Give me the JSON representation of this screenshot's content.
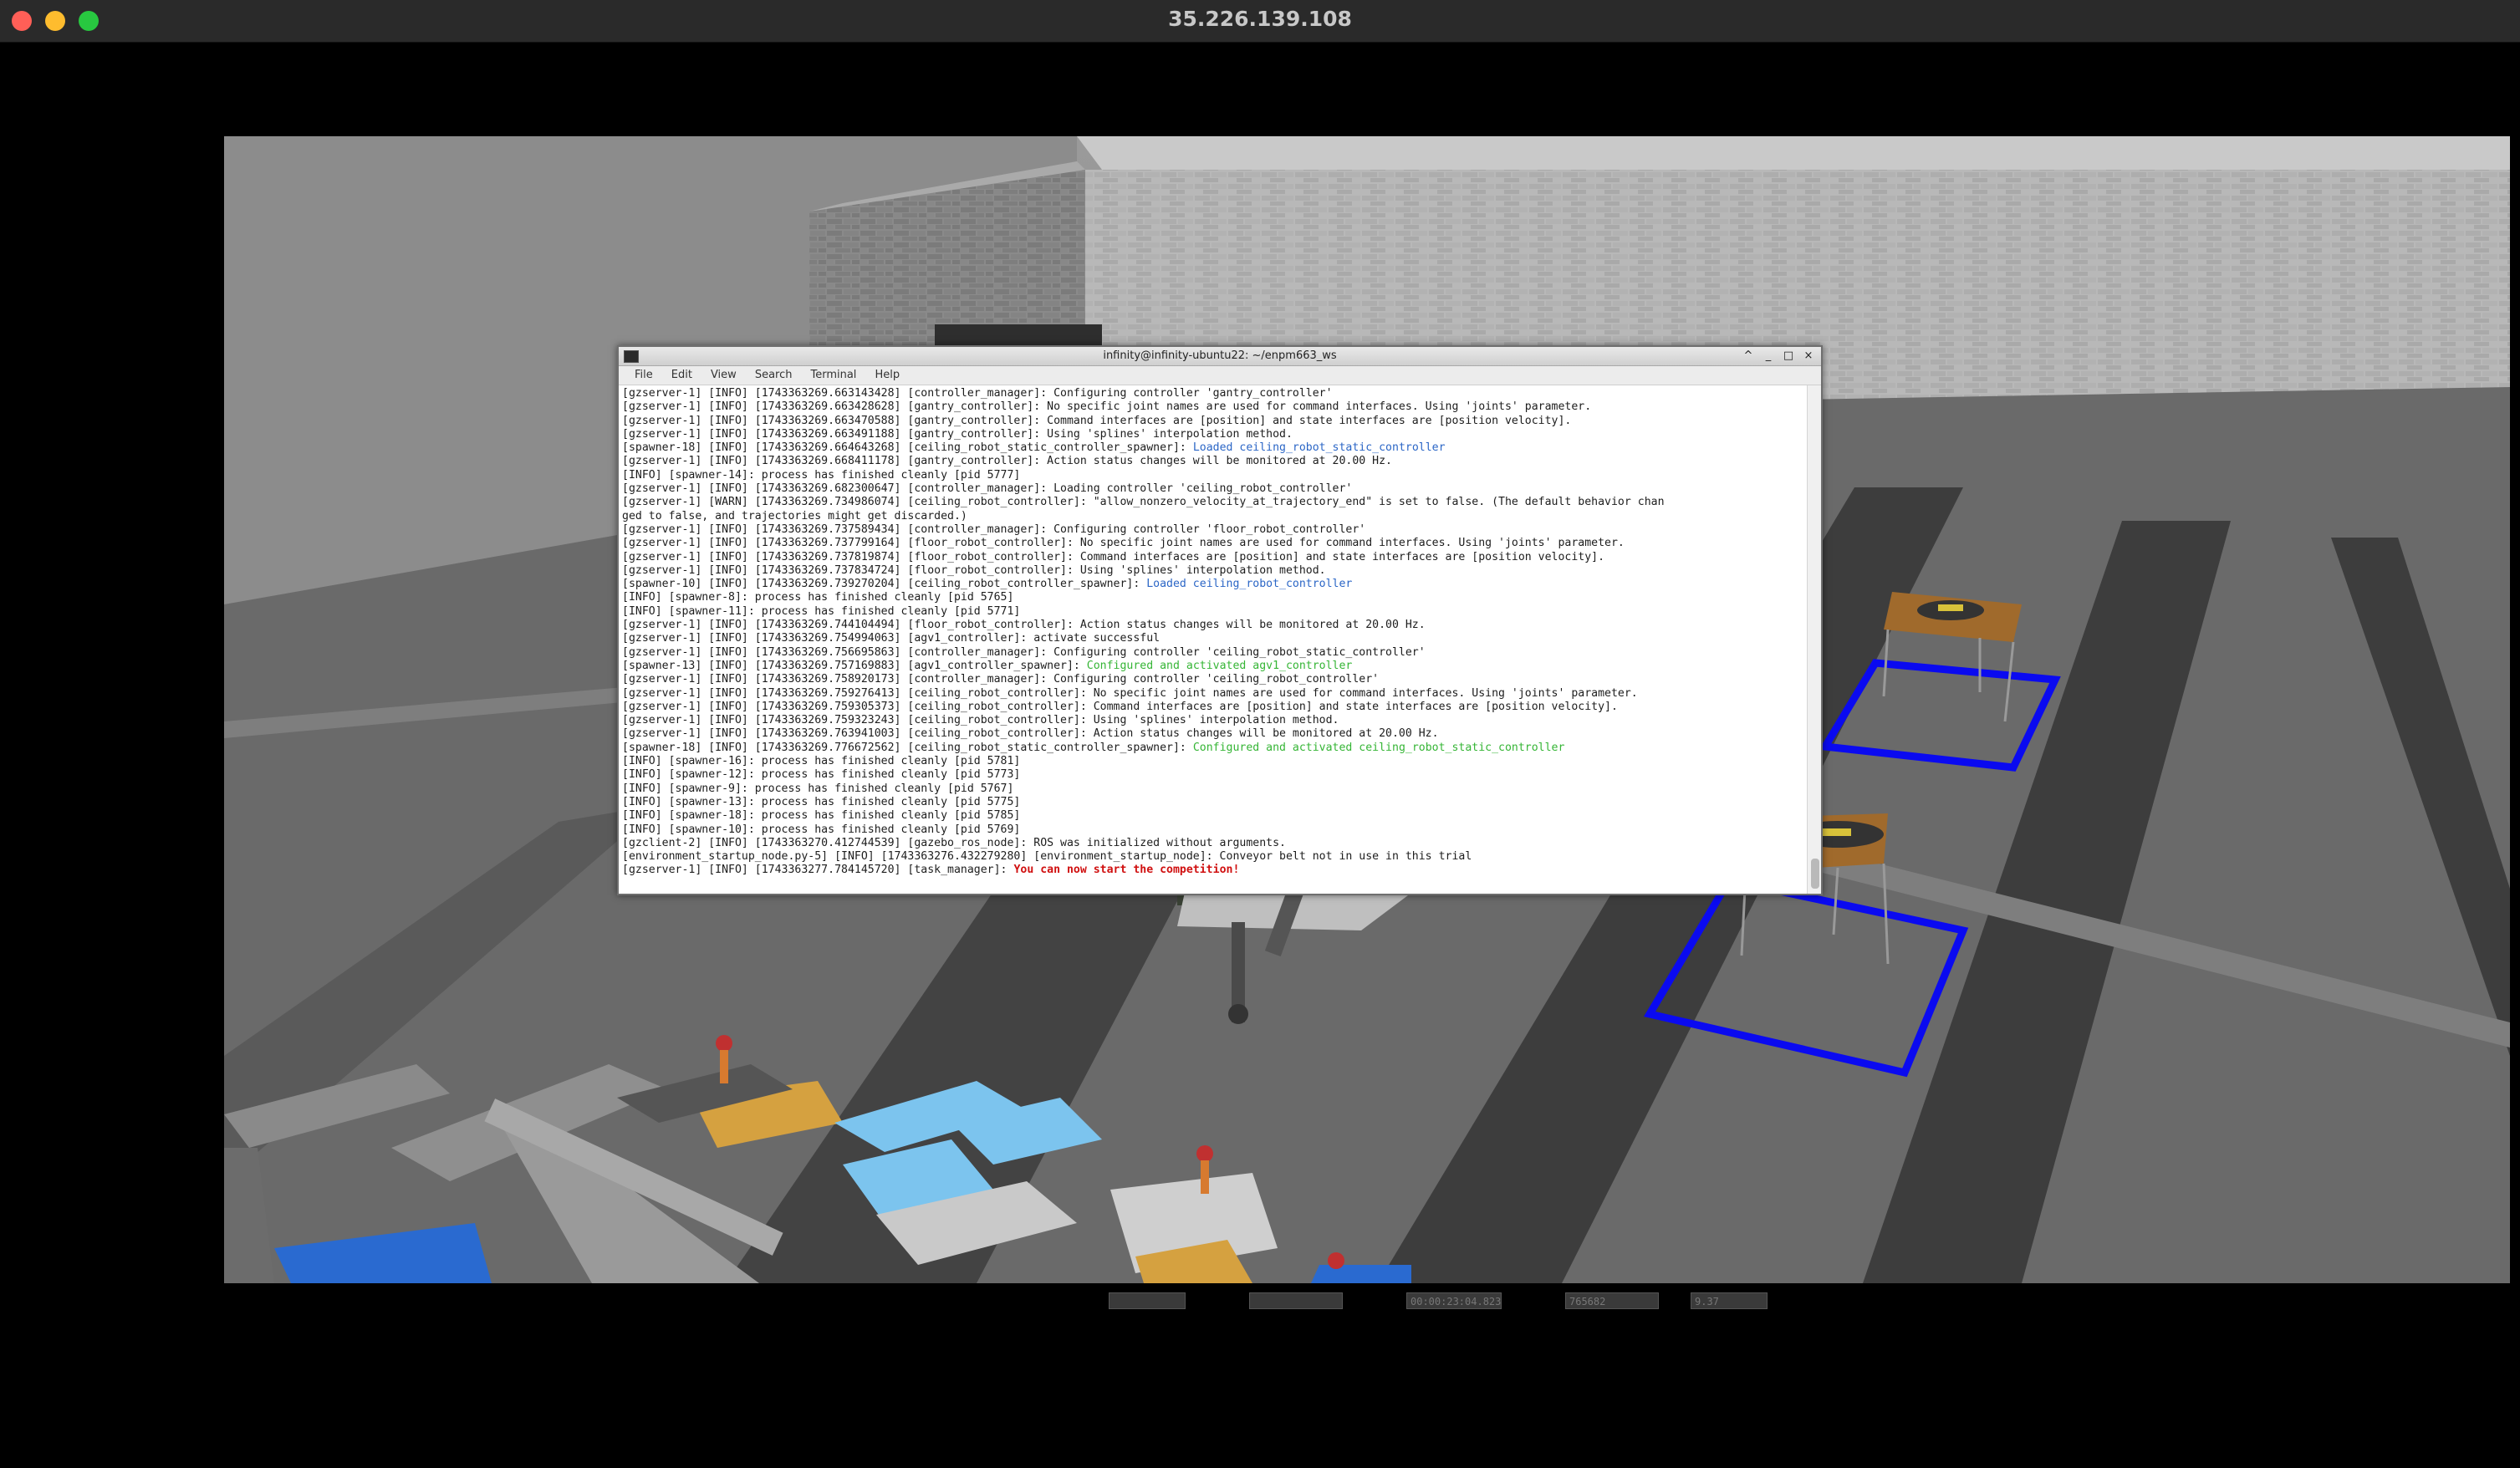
{
  "window": {
    "title": "35.226.139.108"
  },
  "terminal": {
    "title": "infinity@infinity-ubuntu22: ~/enpm663_ws",
    "menu": [
      "File",
      "Edit",
      "View",
      "Search",
      "Terminal",
      "Help"
    ],
    "lines": [
      {
        "text": "[gzserver-1] [INFO] [1743363269.663143428] [controller_manager]: Configuring controller 'gantry_controller'"
      },
      {
        "text": "[gzserver-1] [INFO] [1743363269.663428628] [gantry_controller]: No specific joint names are used for command interfaces. Using 'joints' parameter."
      },
      {
        "text": "[gzserver-1] [INFO] [1743363269.663470588] [gantry_controller]: Command interfaces are [position] and state interfaces are [position velocity]."
      },
      {
        "text": "[gzserver-1] [INFO] [1743363269.663491188] [gantry_controller]: Using 'splines' interpolation method."
      },
      {
        "text": "[spawner-18] [INFO] [1743363269.664643268] [ceiling_robot_static_controller_spawner]: ",
        "hl": "Loaded ceiling_robot_static_controller",
        "hl_class": "hl-blue"
      },
      {
        "text": "[gzserver-1] [INFO] [1743363269.668411178] [gantry_controller]: Action status changes will be monitored at 20.00 Hz."
      },
      {
        "text": "[INFO] [spawner-14]: process has finished cleanly [pid 5777]"
      },
      {
        "text": "[gzserver-1] [INFO] [1743363269.682300647] [controller_manager]: Loading controller 'ceiling_robot_controller'"
      },
      {
        "text": "[gzserver-1] [WARN] [1743363269.734986074] [ceiling_robot_controller]: \"allow_nonzero_velocity_at_trajectory_end\" is set to false. (The default behavior chan"
      },
      {
        "text": "ged to false, and trajectories might get discarded.)"
      },
      {
        "text": "[gzserver-1] [INFO] [1743363269.737589434] [controller_manager]: Configuring controller 'floor_robot_controller'"
      },
      {
        "text": "[gzserver-1] [INFO] [1743363269.737799164] [floor_robot_controller]: No specific joint names are used for command interfaces. Using 'joints' parameter."
      },
      {
        "text": "[gzserver-1] [INFO] [1743363269.737819874] [floor_robot_controller]: Command interfaces are [position] and state interfaces are [position velocity]."
      },
      {
        "text": "[gzserver-1] [INFO] [1743363269.737834724] [floor_robot_controller]: Using 'splines' interpolation method."
      },
      {
        "text": "[spawner-10] [INFO] [1743363269.739270204] [ceiling_robot_controller_spawner]: ",
        "hl": "Loaded ceiling_robot_controller",
        "hl_class": "hl-blue"
      },
      {
        "text": "[INFO] [spawner-8]: process has finished cleanly [pid 5765]"
      },
      {
        "text": "[INFO] [spawner-11]: process has finished cleanly [pid 5771]"
      },
      {
        "text": "[gzserver-1] [INFO] [1743363269.744104494] [floor_robot_controller]: Action status changes will be monitored at 20.00 Hz."
      },
      {
        "text": "[gzserver-1] [INFO] [1743363269.754994063] [agv1_controller]: activate successful"
      },
      {
        "text": "[gzserver-1] [INFO] [1743363269.756695863] [controller_manager]: Configuring controller 'ceiling_robot_static_controller'"
      },
      {
        "text": "[spawner-13] [INFO] [1743363269.757169883] [agv1_controller_spawner]: ",
        "hl": "Configured and activated agv1_controller",
        "hl_class": "hl-green"
      },
      {
        "text": "[gzserver-1] [INFO] [1743363269.758920173] [controller_manager]: Configuring controller 'ceiling_robot_controller'"
      },
      {
        "text": "[gzserver-1] [INFO] [1743363269.759276413] [ceiling_robot_controller]: No specific joint names are used for command interfaces. Using 'joints' parameter."
      },
      {
        "text": "[gzserver-1] [INFO] [1743363269.759305373] [ceiling_robot_controller]: Command interfaces are [position] and state interfaces are [position velocity]."
      },
      {
        "text": "[gzserver-1] [INFO] [1743363269.759323243] [ceiling_robot_controller]: Using 'splines' interpolation method."
      },
      {
        "text": "[gzserver-1] [INFO] [1743363269.763941003] [ceiling_robot_controller]: Action status changes will be monitored at 20.00 Hz."
      },
      {
        "text": "[spawner-18] [INFO] [1743363269.776672562] [ceiling_robot_static_controller_spawner]: ",
        "hl": "Configured and activated ceiling_robot_static_controller",
        "hl_class": "hl-green"
      },
      {
        "text": "[INFO] [spawner-16]: process has finished cleanly [pid 5781]"
      },
      {
        "text": "[INFO] [spawner-12]: process has finished cleanly [pid 5773]"
      },
      {
        "text": "[INFO] [spawner-9]: process has finished cleanly [pid 5767]"
      },
      {
        "text": "[INFO] [spawner-13]: process has finished cleanly [pid 5775]"
      },
      {
        "text": "[INFO] [spawner-18]: process has finished cleanly [pid 5785]"
      },
      {
        "text": "[INFO] [spawner-10]: process has finished cleanly [pid 5769]"
      },
      {
        "text": "[gzclient-2] [INFO] [1743363270.412744539] [gazebo_ros_node]: ROS was initialized without arguments."
      },
      {
        "text": "[environment_startup_node.py-5] [INFO] [1743363276.432279280] [environment_startup_node]: Conveyor belt not in use in this trial"
      },
      {
        "text": "[gzserver-1] [INFO] [1743363277.784145720] [task_manager]: ",
        "hl": "You can now start the competition!",
        "hl_class": "hl-red"
      }
    ]
  },
  "status_bar": {
    "sim_time": "00:00:23:04.823",
    "iterations": "765682",
    "fps": "9.37"
  },
  "colors": {
    "station_outline": "#0a0af0",
    "table_top": "#a06a2c",
    "agv_body": "#e6b84a",
    "tray_blue": "#7cc4ee"
  }
}
